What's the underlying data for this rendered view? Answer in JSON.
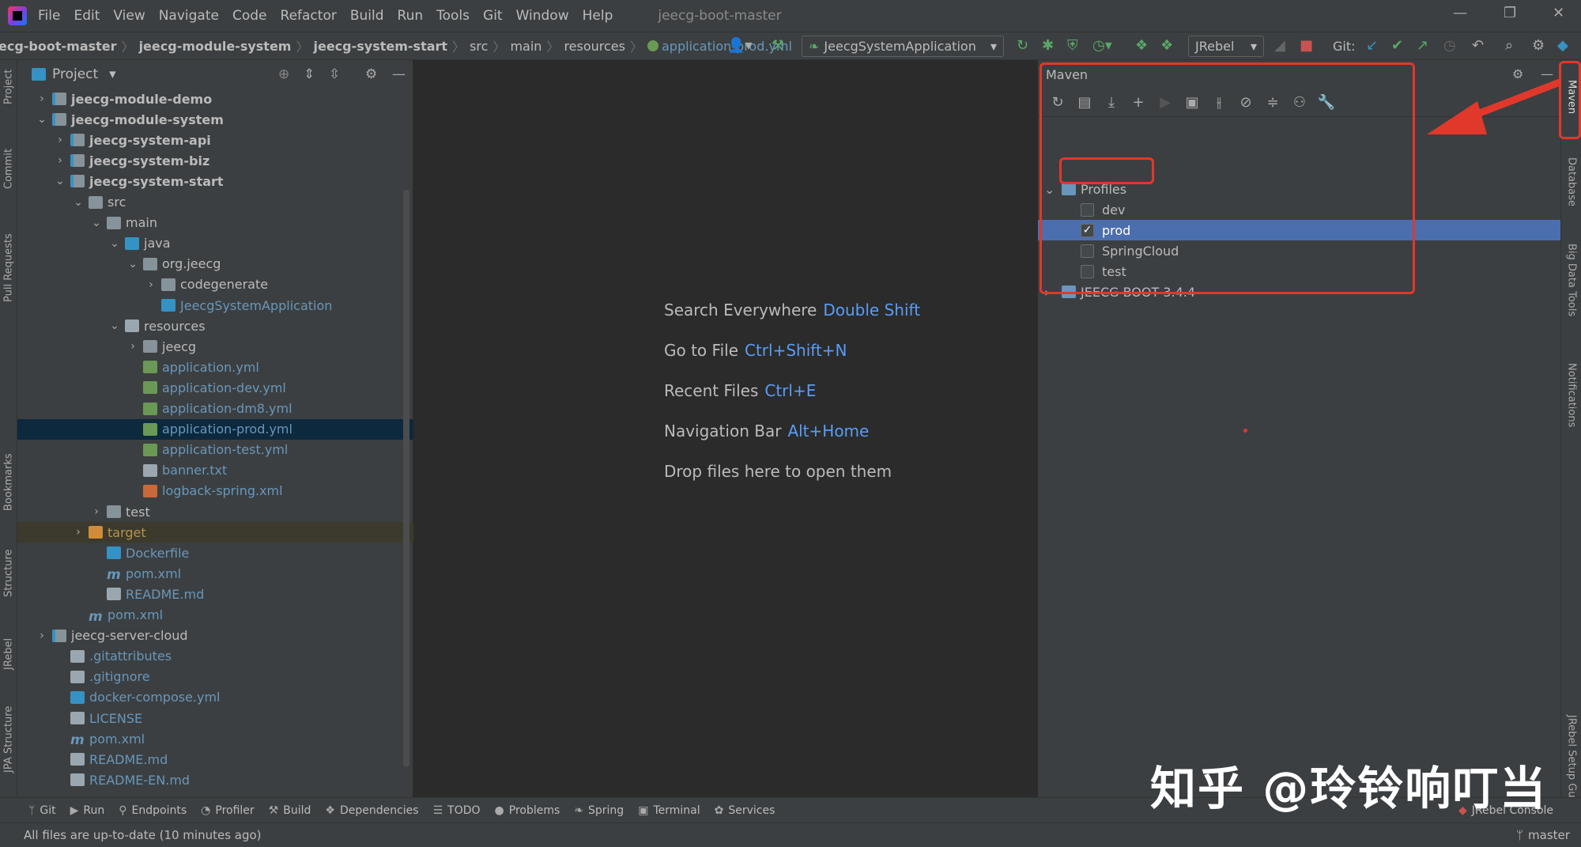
{
  "menubar": {
    "items": [
      {
        "label": "File",
        "u": "F"
      },
      {
        "label": "Edit",
        "u": "E"
      },
      {
        "label": "View",
        "u": "V"
      },
      {
        "label": "Navigate",
        "u": "N"
      },
      {
        "label": "Code",
        "u": "C"
      },
      {
        "label": "Refactor",
        "u": "R"
      },
      {
        "label": "Build",
        "u": "B"
      },
      {
        "label": "Run",
        "u": "u"
      },
      {
        "label": "Tools",
        "u": "T"
      },
      {
        "label": "Git",
        "u": "G"
      },
      {
        "label": "Window",
        "u": "W"
      },
      {
        "label": "Help",
        "u": "H"
      }
    ],
    "window_title": "jeecg-boot-master"
  },
  "navbar": {
    "crumbs": [
      {
        "label": "ecg-boot-master",
        "style": "bold"
      },
      {
        "label": "jeecg-module-system",
        "style": "bold"
      },
      {
        "label": "jeecg-system-start",
        "style": "bold"
      },
      {
        "label": "src",
        "style": "plain"
      },
      {
        "label": "main",
        "style": "plain"
      },
      {
        "label": "resources",
        "style": "plain"
      },
      {
        "label": "application-prod.yml",
        "style": "file"
      }
    ],
    "run_config": "JeecgSystemApplication",
    "jrebel": "JRebel",
    "git_label": "Git:"
  },
  "left_tabs": [
    "Project",
    "Commit",
    "Pull Requests",
    "Bookmarks",
    "Structure",
    "JRebel",
    "JPA Structure"
  ],
  "right_tabs": [
    "Maven",
    "Database",
    "Big Data Tools",
    "Notifications",
    "JRebel Setup Guide"
  ],
  "project": {
    "header": "Project",
    "rows": [
      {
        "depth": 0,
        "arrow": "›",
        "icon": "fold-mod",
        "label": "jeecg-module-demo",
        "style": "bold"
      },
      {
        "depth": 0,
        "arrow": "⌄",
        "icon": "fold-mod",
        "label": "jeecg-module-system",
        "style": "bold"
      },
      {
        "depth": 1,
        "arrow": "›",
        "icon": "fold-mod",
        "label": "jeecg-system-api",
        "style": "bold"
      },
      {
        "depth": 1,
        "arrow": "›",
        "icon": "fold-mod",
        "label": "jeecg-system-biz",
        "style": "bold"
      },
      {
        "depth": 1,
        "arrow": "⌄",
        "icon": "fold-mod",
        "label": "jeecg-system-start",
        "style": "bold"
      },
      {
        "depth": 2,
        "arrow": "⌄",
        "icon": "fold",
        "label": "src",
        "style": "normal"
      },
      {
        "depth": 3,
        "arrow": "⌄",
        "icon": "fold",
        "label": "main",
        "style": "normal"
      },
      {
        "depth": 4,
        "arrow": "⌄",
        "icon": "fold-src",
        "label": "java",
        "style": "normal"
      },
      {
        "depth": 5,
        "arrow": "⌄",
        "icon": "fold",
        "label": "org.jeecg",
        "style": "normal"
      },
      {
        "depth": 6,
        "arrow": "›",
        "icon": "fold",
        "label": "codegenerate",
        "style": "normal"
      },
      {
        "depth": 6,
        "arrow": "",
        "icon": "ico-java",
        "label": "JeecgSystemApplication",
        "style": "blue"
      },
      {
        "depth": 4,
        "arrow": "⌄",
        "icon": "fold-res",
        "label": "resources",
        "style": "normal"
      },
      {
        "depth": 5,
        "arrow": "›",
        "icon": "fold",
        "label": "jeecg",
        "style": "normal"
      },
      {
        "depth": 5,
        "arrow": "",
        "icon": "ico-yml",
        "label": "application.yml",
        "style": "blue"
      },
      {
        "depth": 5,
        "arrow": "",
        "icon": "ico-yml",
        "label": "application-dev.yml",
        "style": "blue"
      },
      {
        "depth": 5,
        "arrow": "",
        "icon": "ico-yml",
        "label": "application-dm8.yml",
        "style": "blue"
      },
      {
        "depth": 5,
        "arrow": "",
        "icon": "ico-yml",
        "label": "application-prod.yml",
        "style": "blue",
        "selected": true
      },
      {
        "depth": 5,
        "arrow": "",
        "icon": "ico-yml",
        "label": "application-test.yml",
        "style": "blue"
      },
      {
        "depth": 5,
        "arrow": "",
        "icon": "ico-txt",
        "label": "banner.txt",
        "style": "blue"
      },
      {
        "depth": 5,
        "arrow": "",
        "icon": "ico-xml",
        "label": "logback-spring.xml",
        "style": "blue"
      },
      {
        "depth": 3,
        "arrow": "›",
        "icon": "fold",
        "label": "test",
        "style": "normal"
      },
      {
        "depth": 2,
        "arrow": "›",
        "icon": "fold-orange",
        "label": "target",
        "style": "orange",
        "target": true
      },
      {
        "depth": 3,
        "arrow": "",
        "icon": "ico-docker",
        "label": "Dockerfile",
        "style": "blue"
      },
      {
        "depth": 3,
        "arrow": "",
        "icon": "ico-m",
        "label": "pom.xml",
        "style": "blue"
      },
      {
        "depth": 3,
        "arrow": "",
        "icon": "ico-txt",
        "label": "README.md",
        "style": "blue"
      },
      {
        "depth": 2,
        "arrow": "",
        "icon": "ico-m",
        "label": "pom.xml",
        "style": "blue"
      },
      {
        "depth": 0,
        "arrow": "›",
        "icon": "fold-mod",
        "label": "jeecg-server-cloud",
        "style": "normal"
      },
      {
        "depth": 1,
        "arrow": "",
        "icon": "ico-txt",
        "label": ".gitattributes",
        "style": "blue"
      },
      {
        "depth": 1,
        "arrow": "",
        "icon": "ico-txt",
        "label": ".gitignore",
        "style": "blue"
      },
      {
        "depth": 1,
        "arrow": "",
        "icon": "ico-docker",
        "label": "docker-compose.yml",
        "style": "blue"
      },
      {
        "depth": 1,
        "arrow": "",
        "icon": "ico-txt",
        "label": "LICENSE",
        "style": "blue"
      },
      {
        "depth": 1,
        "arrow": "",
        "icon": "ico-m",
        "label": "pom.xml",
        "style": "blue"
      },
      {
        "depth": 1,
        "arrow": "",
        "icon": "ico-txt",
        "label": "README.md",
        "style": "blue"
      },
      {
        "depth": 1,
        "arrow": "",
        "icon": "ico-txt",
        "label": "README-EN.md",
        "style": "blue"
      }
    ]
  },
  "editor": {
    "hints": [
      {
        "label": "Search Everywhere",
        "key": "Double Shift"
      },
      {
        "label": "Go to File",
        "key": "Ctrl+Shift+N"
      },
      {
        "label": "Recent Files",
        "key": "Ctrl+E"
      },
      {
        "label": "Navigation Bar",
        "key": "Alt+Home"
      },
      {
        "label": "Drop files here to open them",
        "key": ""
      }
    ]
  },
  "maven": {
    "header": "Maven",
    "rows": [
      {
        "indent": 0,
        "arrow": "⌄",
        "label": "Profiles",
        "checkbox": false,
        "icon": true
      },
      {
        "indent": 1,
        "arrow": "",
        "label": "dev",
        "checkbox": true,
        "checked": false
      },
      {
        "indent": 1,
        "arrow": "",
        "label": "prod",
        "checkbox": true,
        "checked": true,
        "selected": true
      },
      {
        "indent": 1,
        "arrow": "",
        "label": "SpringCloud",
        "checkbox": true,
        "checked": false
      },
      {
        "indent": 1,
        "arrow": "",
        "label": "test",
        "checkbox": true,
        "checked": false
      },
      {
        "indent": 0,
        "arrow": "›",
        "label": "JEECG BOOT 3.4.4",
        "checkbox": false,
        "icon": true
      }
    ]
  },
  "bottom_tabs": [
    {
      "icon": "ᛘ",
      "label": "Git"
    },
    {
      "icon": "▶",
      "label": "Run"
    },
    {
      "icon": "⚲",
      "label": "Endpoints"
    },
    {
      "icon": "◔",
      "label": "Profiler"
    },
    {
      "icon": "⚒",
      "label": "Build"
    },
    {
      "icon": "❖",
      "label": "Dependencies"
    },
    {
      "icon": "☰",
      "label": "TODO"
    },
    {
      "icon": "●",
      "label": "Problems"
    },
    {
      "icon": "❧",
      "label": "Spring"
    },
    {
      "icon": "▣",
      "label": "Terminal"
    },
    {
      "icon": "✿",
      "label": "Services"
    }
  ],
  "jrebel_console": "JRebel Console",
  "status": {
    "message": "All files are up-to-date (10 minutes ago)",
    "branch": "master"
  },
  "watermark": "知乎 @玲铃响叮当",
  "colors": {
    "accent": "#e0382b",
    "selection": "#4b6eaf",
    "link": "#589df6"
  }
}
